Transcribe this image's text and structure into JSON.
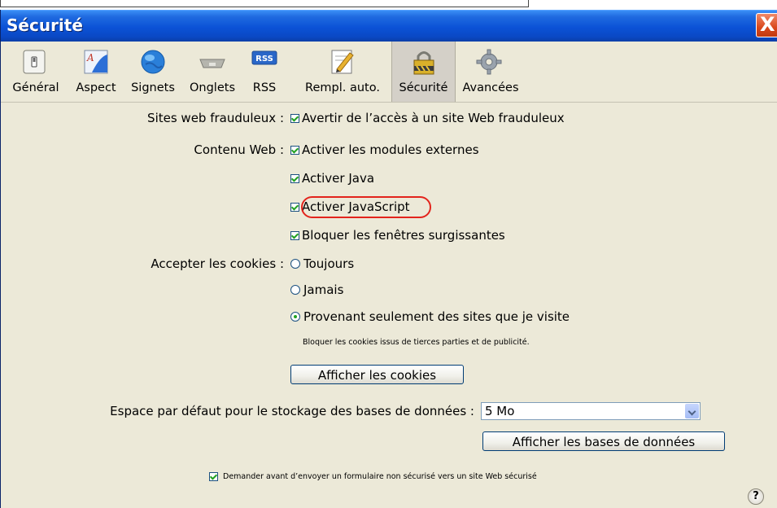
{
  "window": {
    "title": "Sécurité",
    "close_label": "X"
  },
  "toolbar": {
    "items": [
      {
        "label": "Général",
        "icon": "general-switch-icon"
      },
      {
        "label": "Aspect",
        "icon": "appearance-font-icon"
      },
      {
        "label": "Signets",
        "icon": "bookmarks-globe-icon"
      },
      {
        "label": "Onglets",
        "icon": "tabs-icon"
      },
      {
        "label": "RSS",
        "icon": "rss-icon",
        "badge": "RSS"
      },
      {
        "label": "Rempl. auto.",
        "icon": "autofill-pencil-icon"
      },
      {
        "label": "Sécurité",
        "icon": "security-lock-icon",
        "selected": true
      },
      {
        "label": "Avancées",
        "icon": "advanced-gear-icon"
      }
    ]
  },
  "security": {
    "fraud_label": "Sites web frauduleux :",
    "fraud_option": "Avertir de l’accès à un site Web frauduleux",
    "web_content_label": "Contenu Web :",
    "web_options": [
      "Activer les modules externes",
      "Activer Java",
      "Activer JavaScript",
      "Bloquer les fenêtres surgissantes"
    ],
    "cookies_label": "Accepter les cookies :",
    "cookie_options": [
      "Toujours",
      "Jamais",
      "Provenant seulement des sites que je visite"
    ],
    "cookie_selected": "Provenant seulement des sites que je visite",
    "cookie_hint": "Bloquer les cookies issus de tierces parties et de publicité.",
    "show_cookies_button": "Afficher les cookies",
    "db_label": "Espace par défaut pour le stockage des bases de données :",
    "db_value": "5 Mo",
    "show_db_button": "Afficher les bases de données",
    "warn_insecure_form": "Demander avant d’envoyer un formulaire non sécurisé vers un site Web sécurisé",
    "help_label": "?"
  },
  "colors": {
    "titlebar": "#0b52d6",
    "highlight": "#e3241c",
    "check": "#21a121"
  }
}
